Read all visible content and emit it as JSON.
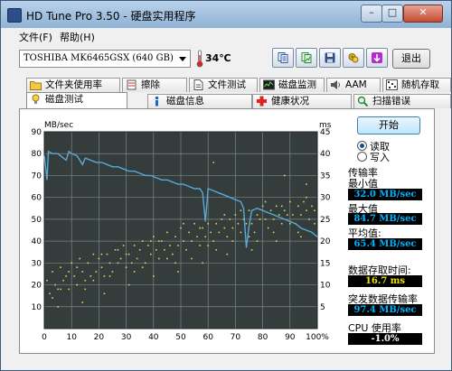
{
  "window": {
    "title": "HD Tune Pro 3.50 - 硬盘实用程序"
  },
  "menu": {
    "file": "文件(F)",
    "help": "帮助(H)"
  },
  "toolbar": {
    "drive": "TOSHIBA MK6465GSX (640 GB)",
    "temperature": "34℃",
    "exit_label": "退出",
    "buttons": [
      "copy-text-icon",
      "copy-screenshot-icon",
      "save-icon",
      "options-icon",
      "download-icon"
    ]
  },
  "tabs_top": [
    "文件夹使用率",
    "擦除",
    "文件测试",
    "磁盘监测",
    "AAM",
    "随机存取"
  ],
  "tabs_bottom": [
    "磁盘测试",
    "磁盘信息",
    "健康状况",
    "扫描错误"
  ],
  "panel": {
    "start_label": "开始",
    "read_label": "读取",
    "write_label": "写入",
    "transfer_rate_label": "传输率",
    "min_label": "最小值",
    "min_value": "32.0 MB/sec",
    "max_label": "最大值",
    "max_value": "84.7 MB/sec",
    "avg_label": "平均值:",
    "avg_value": "65.4 MB/sec",
    "access_label": "数据存取时间:",
    "access_value": "16.7 ms",
    "burst_label": "突发数据传输率",
    "burst_value": "97.4 MB/sec",
    "cpu_label": "CPU 使用率",
    "cpu_value": "-1.0%"
  },
  "colors": {
    "chart_bg": "#343c3c",
    "transfer_line": "#5aaad8",
    "access_points": "#d8d85a",
    "min_value": "#00b4ff",
    "max_value": "#00b4ff",
    "avg_value": "#00b4ff",
    "access_value": "#f0e000",
    "burst_value": "#00b4ff",
    "cpu_value": "#ffffff"
  },
  "chart_data": {
    "type": "line",
    "y_left_label": "MB/sec",
    "y_right_label": "ms",
    "x_ticks": [
      "0",
      "10",
      "20",
      "30",
      "40",
      "50",
      "60",
      "70",
      "80",
      "90",
      "100%"
    ],
    "y_left_ticks": [
      "90",
      "80",
      "70",
      "60",
      "50",
      "40",
      "30",
      "20",
      "10"
    ],
    "y_right_ticks": [
      "45",
      "40",
      "35",
      "30",
      "25",
      "20",
      "15",
      "10",
      "5"
    ],
    "xlim": [
      0,
      100
    ],
    "ylim_left": [
      0,
      90
    ],
    "ylim_right": [
      0,
      45
    ],
    "grid": true,
    "series": [
      {
        "values": [
          [
            0,
            79
          ],
          [
            1,
            68
          ],
          [
            1.5,
            81
          ],
          [
            3,
            80
          ],
          [
            5,
            80
          ],
          [
            7,
            78
          ],
          [
            8,
            77
          ],
          [
            9,
            81
          ],
          [
            10,
            80
          ],
          [
            12,
            79
          ],
          [
            14,
            75
          ],
          [
            15,
            78
          ],
          [
            17,
            77
          ],
          [
            19,
            76
          ],
          [
            21,
            76
          ],
          [
            23,
            75
          ],
          [
            25,
            74
          ],
          [
            27,
            74
          ],
          [
            29,
            73
          ],
          [
            31,
            72
          ],
          [
            33,
            72
          ],
          [
            35,
            71
          ],
          [
            37,
            70
          ],
          [
            39,
            70
          ],
          [
            41,
            69
          ],
          [
            43,
            68
          ],
          [
            45,
            68
          ],
          [
            47,
            67
          ],
          [
            49,
            66
          ],
          [
            51,
            66
          ],
          [
            53,
            65
          ],
          [
            55,
            64
          ],
          [
            57,
            64
          ],
          [
            58,
            62
          ],
          [
            59,
            49
          ],
          [
            60,
            64
          ],
          [
            62,
            63
          ],
          [
            64,
            62
          ],
          [
            66,
            61
          ],
          [
            68,
            60
          ],
          [
            70,
            59
          ],
          [
            72,
            58
          ],
          [
            73,
            55
          ],
          [
            74,
            37
          ],
          [
            75,
            47
          ],
          [
            76,
            54
          ],
          [
            78,
            55
          ],
          [
            80,
            54
          ],
          [
            82,
            53
          ],
          [
            84,
            52
          ],
          [
            86,
            51
          ],
          [
            88,
            50
          ],
          [
            90,
            49
          ],
          [
            92,
            48
          ],
          [
            94,
            46
          ],
          [
            96,
            45
          ],
          [
            98,
            44
          ],
          [
            100,
            42
          ]
        ]
      },
      {
        "values": [
          [
            1,
            11
          ],
          [
            2,
            8
          ],
          [
            3,
            13
          ],
          [
            4,
            10
          ],
          [
            5,
            9
          ],
          [
            6,
            14
          ],
          [
            7,
            11
          ],
          [
            8,
            12
          ],
          [
            9,
            9
          ],
          [
            10,
            15
          ],
          [
            11,
            12
          ],
          [
            12,
            10
          ],
          [
            13,
            16
          ],
          [
            14,
            13
          ],
          [
            15,
            11
          ],
          [
            16,
            15
          ],
          [
            17,
            12
          ],
          [
            18,
            17
          ],
          [
            19,
            13
          ],
          [
            20,
            16
          ],
          [
            21,
            14
          ],
          [
            22,
            12
          ],
          [
            23,
            17
          ],
          [
            24,
            15
          ],
          [
            25,
            13
          ],
          [
            26,
            18
          ],
          [
            27,
            15
          ],
          [
            28,
            16
          ],
          [
            29,
            19
          ],
          [
            30,
            14
          ],
          [
            31,
            17
          ],
          [
            32,
            15
          ],
          [
            33,
            19
          ],
          [
            34,
            16
          ],
          [
            35,
            18
          ],
          [
            36,
            20
          ],
          [
            37,
            15
          ],
          [
            38,
            19
          ],
          [
            39,
            17
          ],
          [
            40,
            21
          ],
          [
            41,
            18
          ],
          [
            42,
            16
          ],
          [
            43,
            20
          ],
          [
            44,
            18
          ],
          [
            45,
            22
          ],
          [
            46,
            19
          ],
          [
            47,
            17
          ],
          [
            48,
            21
          ],
          [
            49,
            19
          ],
          [
            50,
            23
          ],
          [
            51,
            20
          ],
          [
            52,
            18
          ],
          [
            53,
            22
          ],
          [
            54,
            20
          ],
          [
            55,
            24
          ],
          [
            56,
            21
          ],
          [
            57,
            19
          ],
          [
            58,
            23
          ],
          [
            59,
            21
          ],
          [
            60,
            24
          ],
          [
            61,
            22
          ],
          [
            62,
            20
          ],
          [
            63,
            24
          ],
          [
            64,
            22
          ],
          [
            65,
            25
          ],
          [
            66,
            23
          ],
          [
            67,
            21
          ],
          [
            68,
            25
          ],
          [
            69,
            23
          ],
          [
            70,
            26
          ],
          [
            71,
            24
          ],
          [
            72,
            22
          ],
          [
            73,
            25
          ],
          [
            74,
            24
          ],
          [
            75,
            27
          ],
          [
            76,
            24
          ],
          [
            77,
            22
          ],
          [
            78,
            26
          ],
          [
            79,
            25
          ],
          [
            80,
            28
          ],
          [
            81,
            25
          ],
          [
            82,
            23
          ],
          [
            83,
            27
          ],
          [
            84,
            25
          ],
          [
            85,
            28
          ],
          [
            86,
            26
          ],
          [
            87,
            24
          ],
          [
            88,
            27
          ],
          [
            89,
            26
          ],
          [
            90,
            29
          ],
          [
            91,
            26
          ],
          [
            92,
            24
          ],
          [
            93,
            28
          ],
          [
            94,
            26
          ],
          [
            95,
            29
          ],
          [
            96,
            27
          ],
          [
            97,
            25
          ],
          [
            98,
            28
          ],
          [
            99,
            27
          ],
          [
            3,
            7
          ],
          [
            6,
            9
          ],
          [
            9,
            13
          ],
          [
            12,
            14
          ],
          [
            15,
            9
          ],
          [
            18,
            11
          ],
          [
            21,
            17
          ],
          [
            24,
            12
          ],
          [
            27,
            18
          ],
          [
            30,
            17
          ],
          [
            33,
            13
          ],
          [
            36,
            14
          ],
          [
            39,
            20
          ],
          [
            42,
            20
          ],
          [
            45,
            16
          ],
          [
            48,
            15
          ],
          [
            51,
            24
          ],
          [
            54,
            16
          ],
          [
            57,
            23
          ],
          [
            60,
            19
          ],
          [
            63,
            18
          ],
          [
            66,
            26
          ],
          [
            69,
            20
          ],
          [
            72,
            27
          ],
          [
            75,
            21
          ],
          [
            78,
            20
          ],
          [
            81,
            29
          ],
          [
            84,
            22
          ],
          [
            87,
            28
          ],
          [
            90,
            24
          ],
          [
            93,
            22
          ],
          [
            96,
            30
          ],
          [
            99,
            24
          ],
          [
            5,
            5
          ],
          [
            14,
            6
          ],
          [
            22,
            8
          ],
          [
            31,
            10
          ],
          [
            40,
            12
          ],
          [
            49,
            13
          ],
          [
            58,
            15
          ],
          [
            67,
            17
          ],
          [
            76,
            18
          ],
          [
            85,
            20
          ],
          [
            94,
            21
          ],
          [
            62,
            38
          ],
          [
            88,
            35
          ],
          [
            96,
            33
          ]
        ]
      }
    ]
  }
}
